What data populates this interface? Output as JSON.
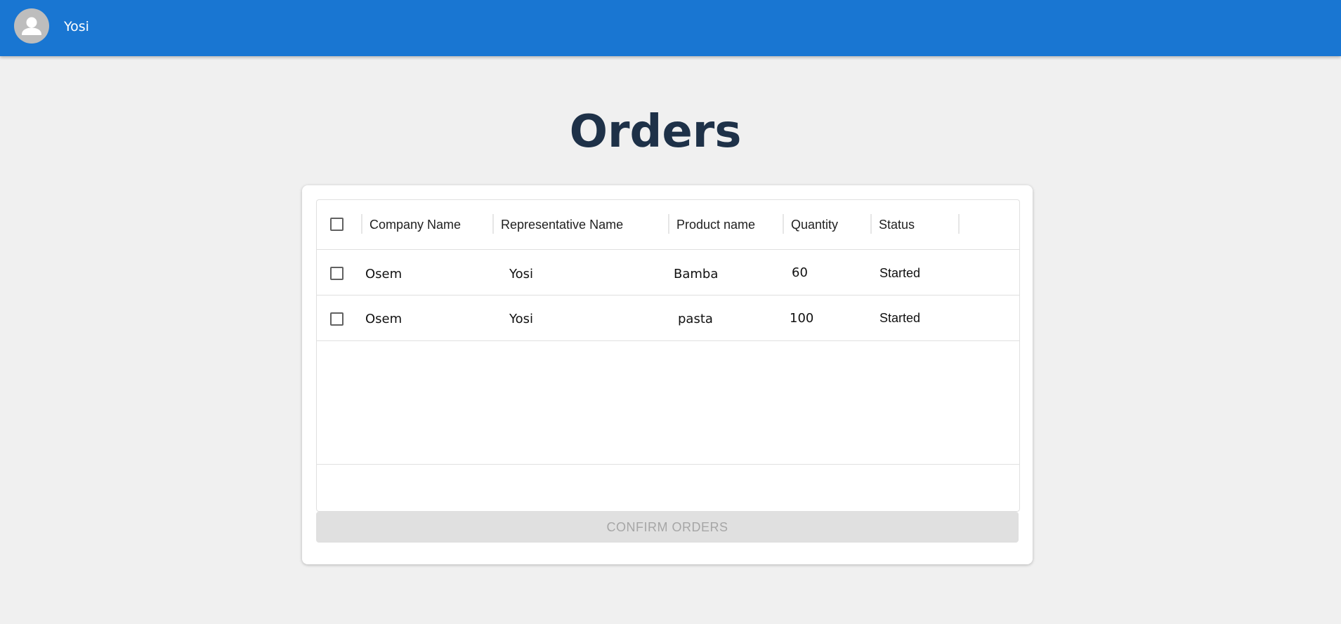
{
  "appbar": {
    "username": "Yosi",
    "avatar_icon": "person-icon",
    "color": "#1976d2"
  },
  "page": {
    "title": "Orders"
  },
  "table": {
    "columns": [
      "Company Name",
      "Representative Name",
      "Product name",
      "Quantity",
      "Status"
    ],
    "rows": [
      {
        "company": "Osem",
        "representative": "Yosi",
        "product": "Bamba",
        "quantity": "60",
        "status": "Started",
        "selected": false
      },
      {
        "company": "Osem",
        "representative": "Yosi",
        "product": "pasta",
        "quantity": "100",
        "status": "Started",
        "selected": false
      }
    ],
    "select_all": false
  },
  "actions": {
    "confirm_label": "CONFIRM ORDERS",
    "confirm_disabled": true
  }
}
